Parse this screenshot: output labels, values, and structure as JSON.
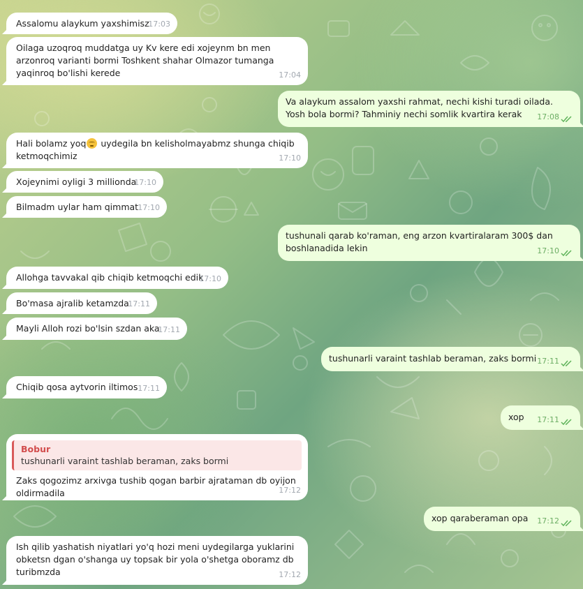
{
  "chat": {
    "messages": [
      {
        "direction": "in",
        "text": "Assalomu alaykum yaxshimisz",
        "time": "17:03"
      },
      {
        "direction": "in",
        "text": "Oilaga uzoqroq muddatga uy Kv kere edi xojeynm bn men arzonroq varianti bormi Toshkent shahar Olmazor tumanga yaqinroq bo'lishi kerede",
        "time": "17:04"
      },
      {
        "direction": "out",
        "text": "Va alaykum assalom yaxshi rahmat, nechi kishi turadi oilada. Yosh bola bormi? Tahminiy nechi somlik kvartira kerak",
        "time": "17:08",
        "status": "read"
      },
      {
        "direction": "in",
        "text_before": "Hali bolamz yoq",
        "emoji": "pensive-face-emoji",
        "text_after": " uydegila bn kelisholmayabmz shunga chiqib ketmoqchimiz",
        "time": "17:10"
      },
      {
        "direction": "in",
        "text": "Xojeynimi oyligi 3 millionda",
        "time": "17:10"
      },
      {
        "direction": "in",
        "text": "Bilmadm uylar ham qimmat",
        "time": "17:10"
      },
      {
        "direction": "out",
        "text": "tushunali qarab ko'raman, eng arzon kvartiralaram 300$ dan boshlanadida lekin",
        "time": "17:10",
        "status": "read"
      },
      {
        "direction": "in",
        "text": "Allohga tavvakal qib chiqib ketmoqchi edik",
        "time": "17:10"
      },
      {
        "direction": "in",
        "text": "Bo'masa ajralib ketamzda",
        "time": "17:11"
      },
      {
        "direction": "in",
        "text": "Mayli Alloh rozi bo'lsin szdan aka",
        "time": "17:11"
      },
      {
        "direction": "out",
        "text": "tushunarli varaint tashlab beraman, zaks bormi",
        "time": "17:11",
        "status": "read"
      },
      {
        "direction": "in",
        "text": "Chiqib qosa aytvorin iltimos",
        "time": "17:11"
      },
      {
        "direction": "out",
        "text": "xop",
        "time": "17:11",
        "status": "read"
      },
      {
        "direction": "in",
        "reply": {
          "name": "Bobur",
          "text": "tushunarli varaint tashlab beraman, zaks bormi"
        },
        "text": "Zaks qogozimz arxivga tushib qogan barbir ajrataman db oyijon oldirmadila",
        "time": "17:12"
      },
      {
        "direction": "out",
        "text": "xop qaraberaman opa",
        "time": "17:12",
        "status": "read"
      },
      {
        "direction": "in",
        "text": "Ish qilib yashatish niyatlari yo'q hozi meni uydegilarga yuklarini obketsn dgan o'shanga uy topsak bir yola o'shetga oboramz db turibmzda",
        "time": "17:12"
      }
    ]
  },
  "theme": {
    "incoming_bubble": "#ffffff",
    "outgoing_bubble": "#eeffde",
    "outgoing_time_color": "#6dae65",
    "incoming_time_color": "#a2a8b0",
    "reply_accent": "#d24d4d",
    "read_receipt_icon": "double-check-icon"
  }
}
